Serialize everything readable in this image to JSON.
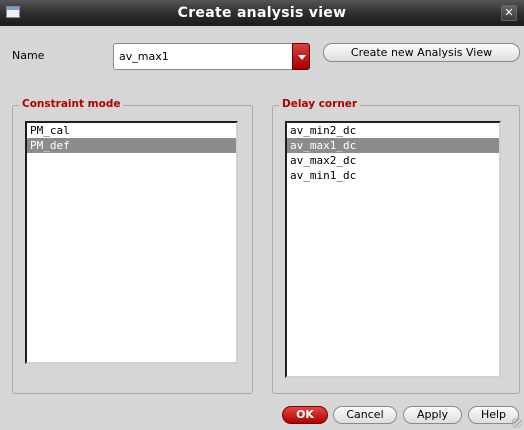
{
  "window": {
    "title": "Create analysis view",
    "close_glyph": "✕"
  },
  "name_row": {
    "label": "Name",
    "value": "av_max1",
    "create_button": "Create new Analysis View"
  },
  "constraint_mode": {
    "title": "Constraint mode",
    "items": [
      "PM_cal",
      "PM_def"
    ],
    "selected_index": 1
  },
  "delay_corner": {
    "title": "Delay corner",
    "items": [
      "av_min2_dc",
      "av_max1_dc",
      "av_max2_dc",
      "av_min1_dc"
    ],
    "selected_index": 1
  },
  "buttons": {
    "ok": "OK",
    "cancel": "Cancel",
    "apply": "Apply",
    "help": "Help"
  },
  "colors": {
    "accent_red": "#b00000",
    "selection": "#8c8c8c"
  }
}
